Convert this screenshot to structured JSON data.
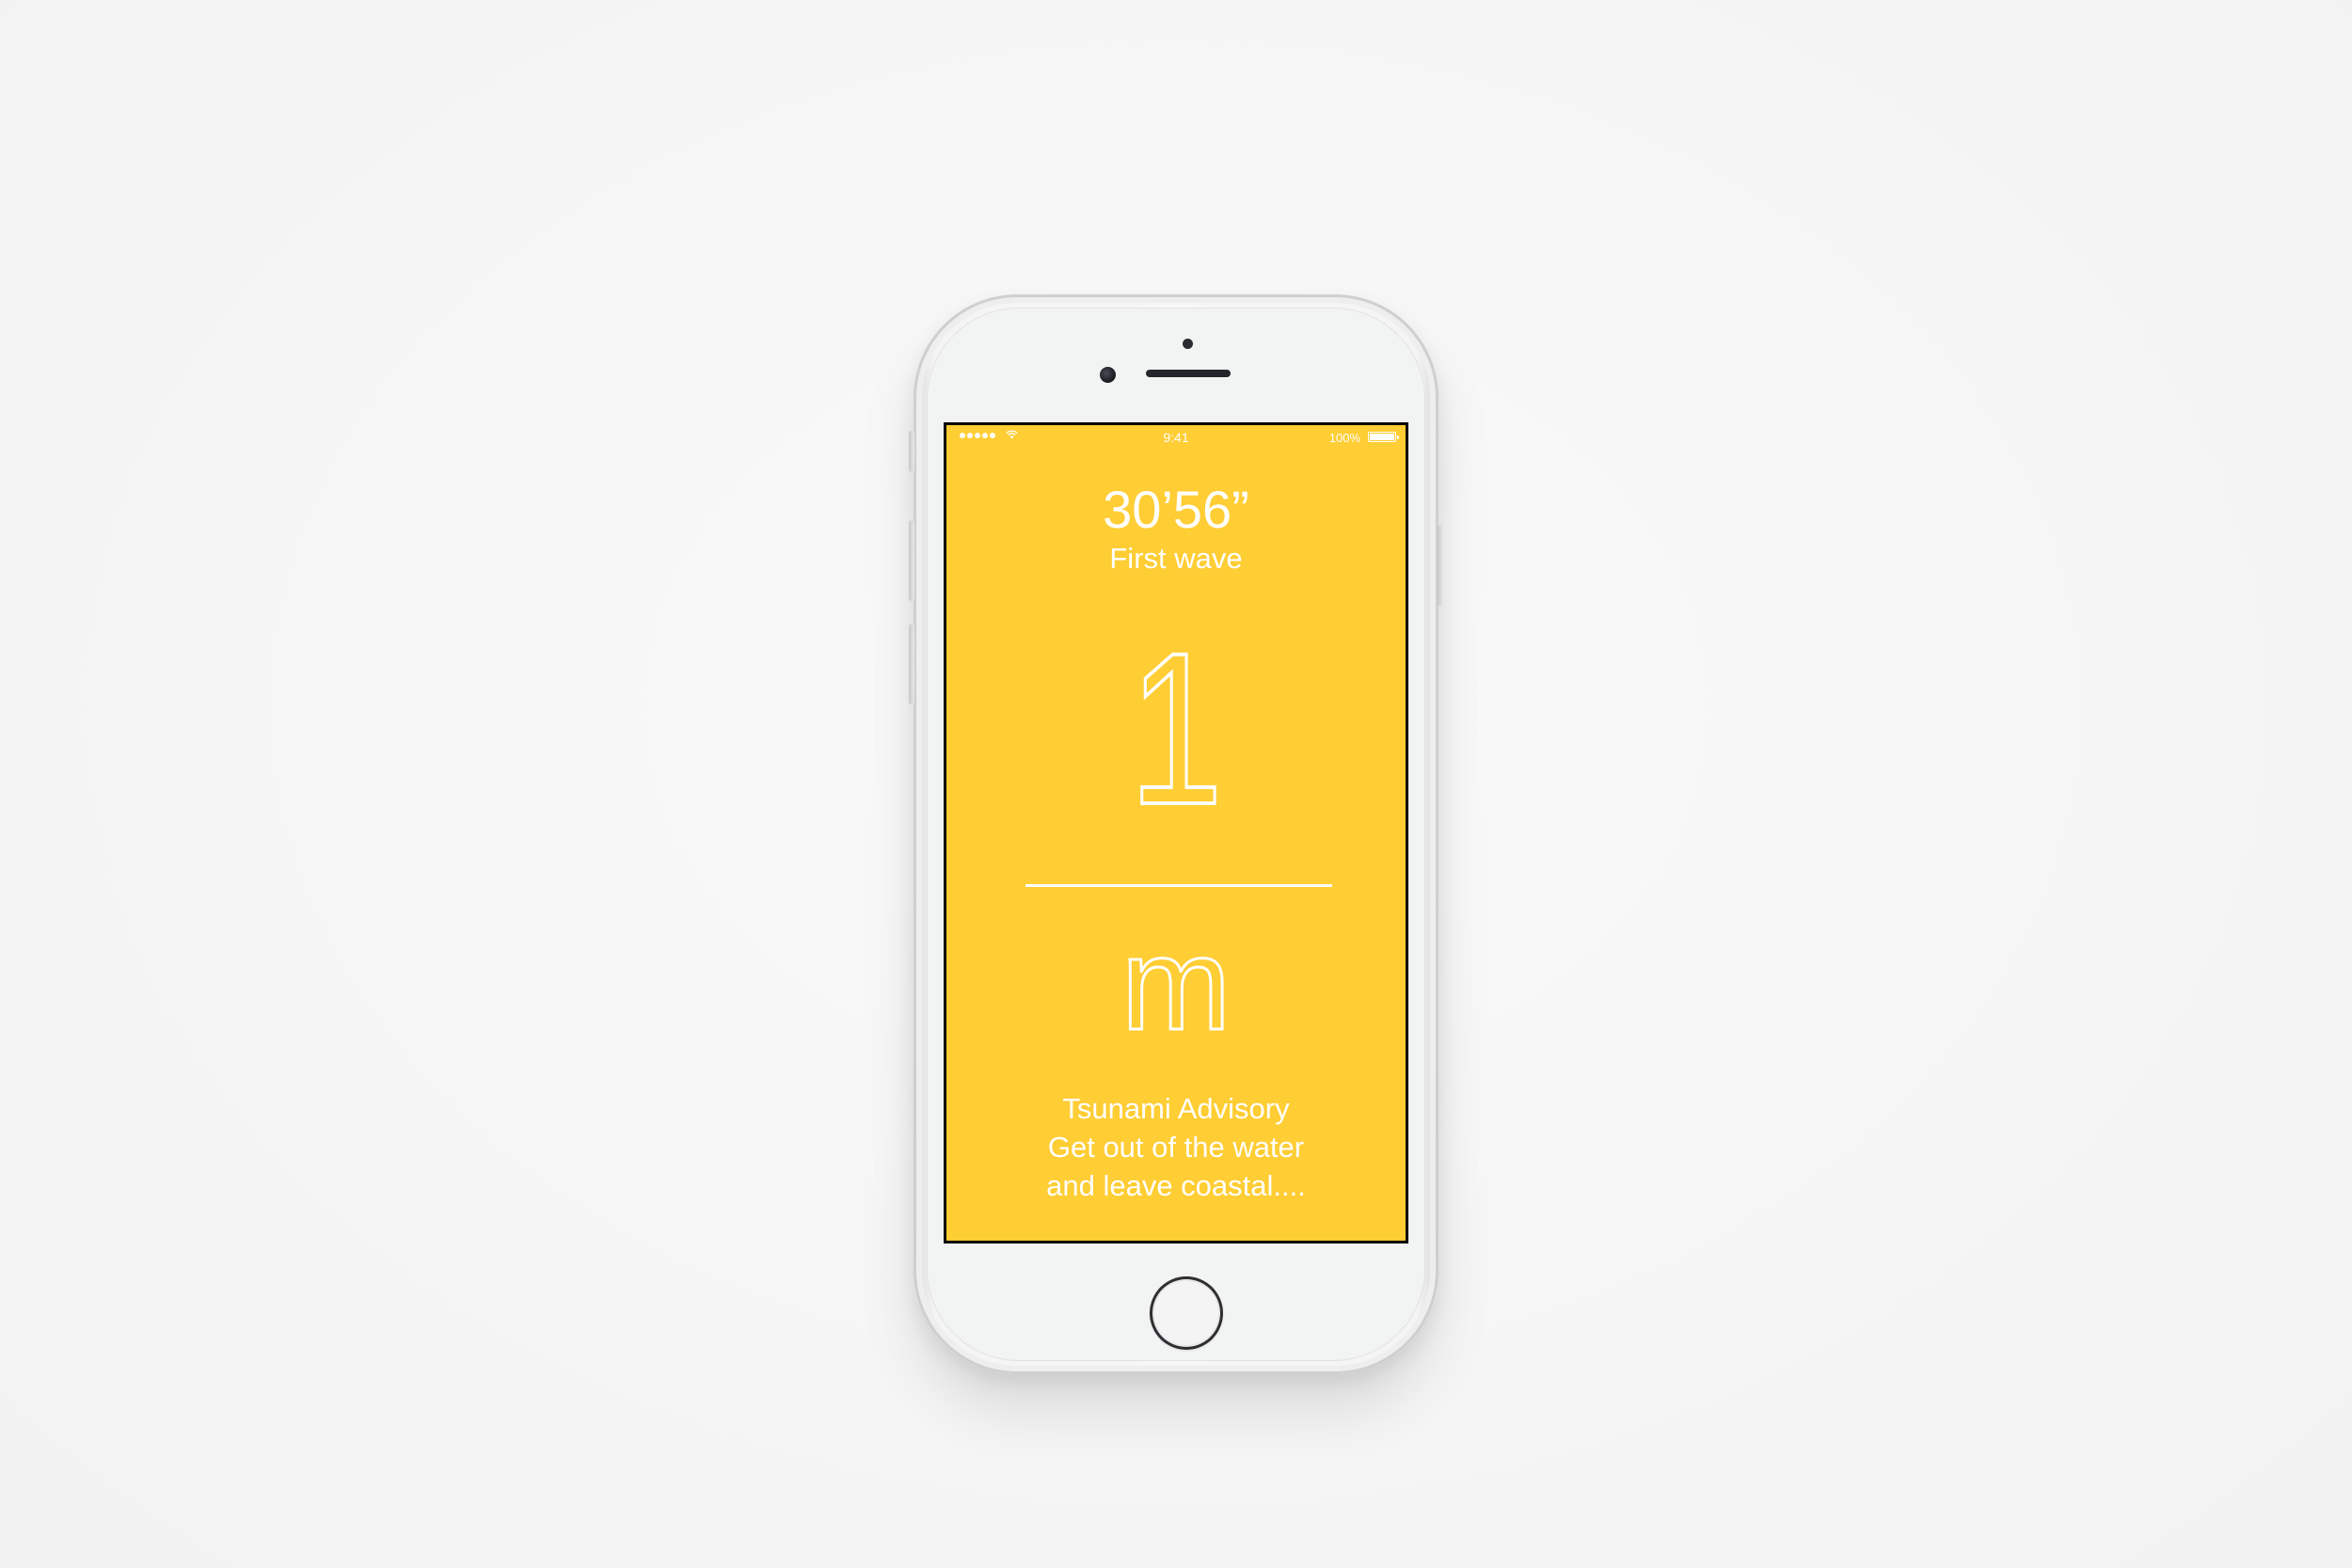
{
  "status_bar": {
    "time": "9:41",
    "battery_percent": "100%",
    "signal_bars": 5,
    "wifi": "wifi-icon",
    "battery_icon": "battery-icon"
  },
  "countdown": {
    "time": "30’56”",
    "label": "First wave"
  },
  "wave_height": {
    "value": "1",
    "unit": "m"
  },
  "alert": {
    "title": "Tsunami Advisory",
    "line1": "Get out of the water",
    "line2": "and leave coastal...."
  },
  "colors": {
    "screen_background": "#ffcd34",
    "text": "#ffffff",
    "page_background": "#f6f6f6"
  }
}
